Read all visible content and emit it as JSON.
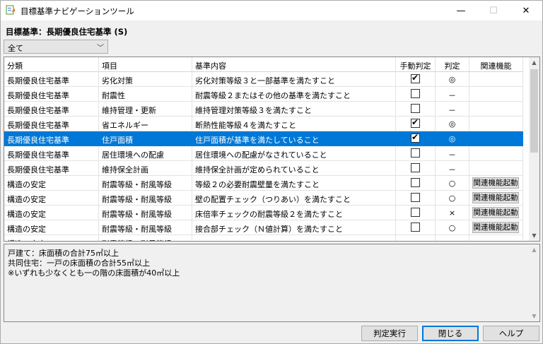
{
  "window": {
    "title": "目標基準ナビゲーションツール",
    "min": "—",
    "max": "☐",
    "close": "✕"
  },
  "target": {
    "label": "目標基準：長期優良住宅基準 (S)"
  },
  "filter": {
    "value": "全て"
  },
  "grid": {
    "headers": [
      "分類",
      "項目",
      "基準内容",
      "手動判定",
      "判定",
      "関連機能"
    ],
    "rows": [
      {
        "cat": "長期優良住宅基準",
        "item": "劣化対策",
        "content": "劣化対策等級３と一部基準を満たすこと",
        "manual": true,
        "result": "◎",
        "action": ""
      },
      {
        "cat": "長期優良住宅基準",
        "item": "耐震性",
        "content": "耐震等級２またはその他の基準を満たすこと",
        "manual": false,
        "result": "－",
        "action": ""
      },
      {
        "cat": "長期優良住宅基準",
        "item": "維持管理・更新",
        "content": "維持管理対策等級３を満たすこと",
        "manual": false,
        "result": "－",
        "action": ""
      },
      {
        "cat": "長期優良住宅基準",
        "item": "省エネルギー",
        "content": "断熱性能等級４を満たすこと",
        "manual": true,
        "result": "◎",
        "action": ""
      },
      {
        "cat": "長期優良住宅基準",
        "item": "住戸面積",
        "content": "住戸面積が基準を満たしていること",
        "manual": true,
        "result": "◎",
        "action": "",
        "selected": true
      },
      {
        "cat": "長期優良住宅基準",
        "item": "居住環境への配慮",
        "content": "居住環境への配慮がなされていること",
        "manual": false,
        "result": "－",
        "action": ""
      },
      {
        "cat": "長期優良住宅基準",
        "item": "維持保全計画",
        "content": "維持保全計画が定められていること",
        "manual": false,
        "result": "－",
        "action": ""
      },
      {
        "cat": "構造の安定",
        "item": "耐震等級・耐風等級",
        "content": "等級２の必要耐震壁量を満たすこと",
        "manual": false,
        "result": "○",
        "action": "関連機能起動"
      },
      {
        "cat": "構造の安定",
        "item": "耐震等級・耐風等級",
        "content": "壁の配置チェック（つりあい）を満たすこと",
        "manual": false,
        "result": "○",
        "action": "関連機能起動"
      },
      {
        "cat": "構造の安定",
        "item": "耐震等級・耐風等級",
        "content": "床倍率チェックの耐震等級２を満たすこと",
        "manual": false,
        "result": "×",
        "action": "関連機能起動"
      },
      {
        "cat": "構造の安定",
        "item": "耐震等級・耐風等級",
        "content": "接合部チェック（Ｎ値計算）を満たすこと",
        "manual": false,
        "result": "○",
        "action": "関連機能起動"
      },
      {
        "cat": "構造の安定",
        "item": "耐震等級・耐風等級",
        "content": "",
        "manual": false,
        "result": "",
        "action": ""
      }
    ]
  },
  "notes": {
    "lines": [
      "戸建て：床面積の合計75㎡以上",
      "共同住宅：一戸の床面積の合計55㎡以上",
      "※いずれも少なくとも一の階の床面積が40㎡以上"
    ]
  },
  "buttons": {
    "judge": "判定実行",
    "close": "閉じる",
    "help": "ヘルプ"
  },
  "colors": {
    "selection": "#0078d7",
    "primary_border": "#0078d7"
  },
  "icons": {
    "app": "app-icon",
    "dropdown": "chevron-down-icon"
  }
}
